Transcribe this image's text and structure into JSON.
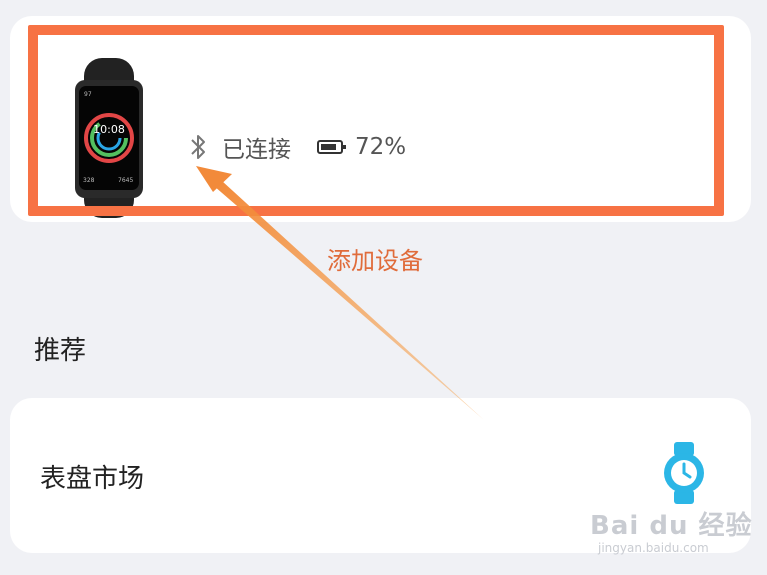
{
  "device": {
    "bluetooth_icon": "bluetooth-icon",
    "status": "已连接",
    "battery_icon": "battery-icon",
    "battery_level": "72%",
    "watch_face": {
      "time": "10:08",
      "steps_left": "328",
      "steps_right": "7645",
      "small_left": "97"
    }
  },
  "add_device_label": "添加设备",
  "recommend": {
    "title": "推荐",
    "items": [
      {
        "label": "表盘市场",
        "icon": "watch-icon"
      }
    ]
  },
  "watermark": {
    "brand": "Bai du 经验",
    "site": "jingyan.baidu.com"
  },
  "colors": {
    "highlight": "#f77244",
    "accent": "#e06c3b",
    "watch_blue": "#2bb6e6"
  }
}
